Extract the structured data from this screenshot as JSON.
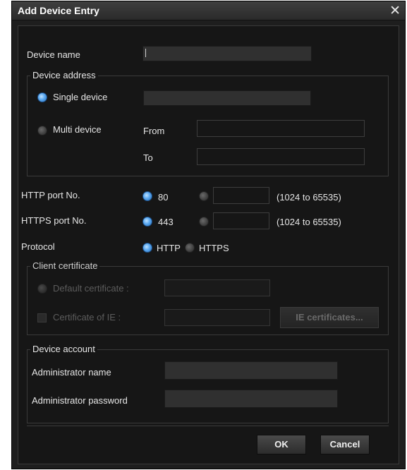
{
  "dialog": {
    "title": "Add Device Entry"
  },
  "device_name": {
    "label": "Device name",
    "value": ""
  },
  "device_address": {
    "legend": "Device address",
    "single_device_label": "Single device",
    "single_device_selected": true,
    "single_device_value": "",
    "multi_device_label": "Multi device",
    "multi_device_selected": false,
    "from_label": "From",
    "from_value": "",
    "to_label": "To",
    "to_value": ""
  },
  "http_port": {
    "label": "HTTP port No.",
    "default_option": "80",
    "default_selected": true,
    "custom_value": "",
    "range_text": "(1024 to 65535)"
  },
  "https_port": {
    "label": "HTTPS port No.",
    "default_option": "443",
    "default_selected": true,
    "custom_value": "",
    "range_text": "(1024 to 65535)"
  },
  "protocol": {
    "label": "Protocol",
    "option_http": "HTTP",
    "option_https": "HTTPS",
    "selected": "HTTP"
  },
  "client_certificate": {
    "legend": "Client certificate",
    "default_certificate_label": "Default certificate :",
    "default_certificate_value": "",
    "certificate_of_ie_label": "Certificate of IE :",
    "certificate_of_ie_value": "",
    "ie_certificates_button": "IE certificates...",
    "enabled": false
  },
  "device_account": {
    "legend": "Device account",
    "admin_name_label": "Administrator name",
    "admin_name_value": "",
    "admin_password_label": "Administrator password",
    "admin_password_value": ""
  },
  "footer": {
    "ok_label": "OK",
    "cancel_label": "Cancel"
  },
  "colors": {
    "accent_radio": "#5aa8f0",
    "background": "#161616",
    "titlebar": "#333333"
  },
  "icons": {
    "close": "close-icon"
  }
}
